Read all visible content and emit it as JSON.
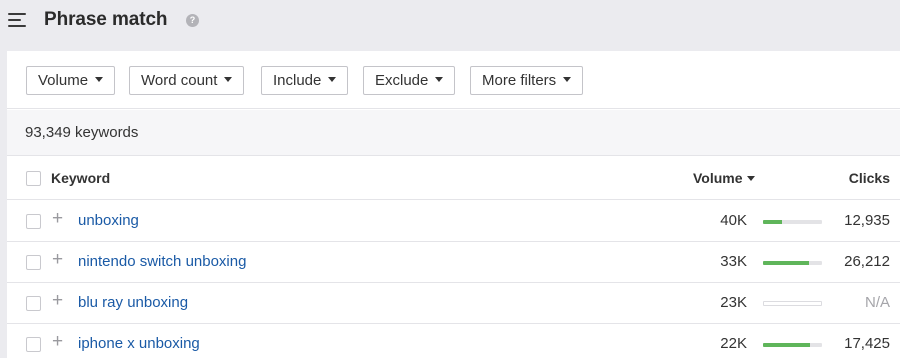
{
  "header": {
    "title": "Phrase match",
    "help_icon": "question-circle-icon",
    "menu_icon": "collapse-menu-icon"
  },
  "filters": [
    {
      "label": "Volume"
    },
    {
      "label": "Word count"
    },
    {
      "label": "Include"
    },
    {
      "label": "Exclude"
    },
    {
      "label": "More filters"
    }
  ],
  "summary": {
    "count_text": "93,349 keywords"
  },
  "table": {
    "headers": {
      "keyword": "Keyword",
      "volume": "Volume",
      "clicks": "Clicks"
    },
    "rows": [
      {
        "keyword": "unboxing",
        "volume": "40K",
        "clicks": "12,935",
        "bar_fill": 0.32
      },
      {
        "keyword": "nintendo switch unboxing",
        "volume": "33K",
        "clicks": "26,212",
        "bar_fill": 0.78
      },
      {
        "keyword": "blu ray unboxing",
        "volume": "23K",
        "clicks": "N/A",
        "bar_fill": 0
      },
      {
        "keyword": "iphone x unboxing",
        "volume": "22K",
        "clicks": "17,425",
        "bar_fill": 0.8
      }
    ]
  },
  "colors": {
    "link": "#1a5aa6",
    "bar_fill": "#5fb55a",
    "background": "#ebebef"
  }
}
